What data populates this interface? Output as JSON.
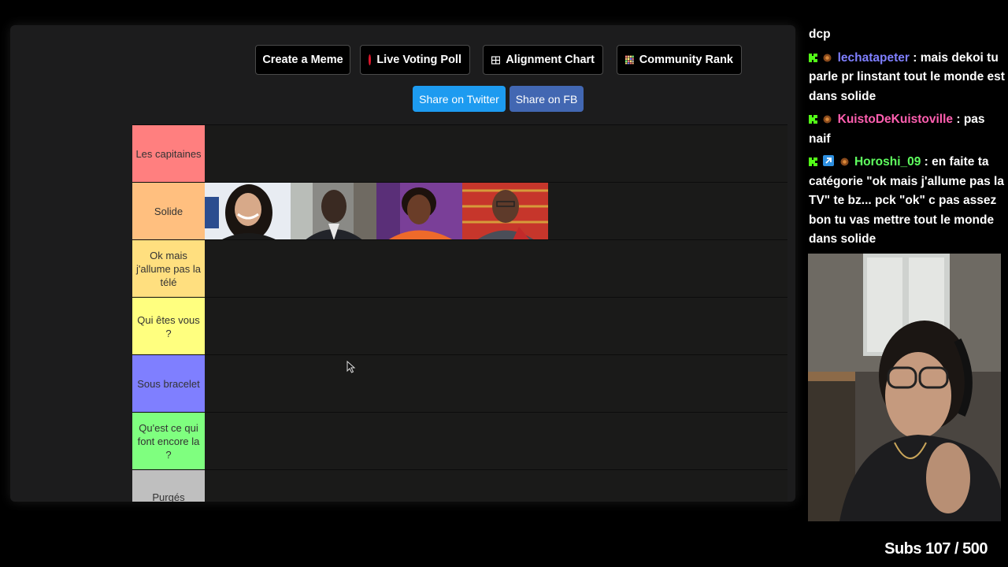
{
  "toolbar": {
    "create_meme": "Create a Meme",
    "live_poll": "Live Voting Poll",
    "alignment": "Alignment Chart",
    "community": "Community Rank",
    "share_twitter": "Share on Twitter",
    "share_fb": "Share on FB"
  },
  "colors": {
    "twitter": "#1d9bf0",
    "facebook": "#4267b2"
  },
  "tiers": [
    {
      "label": "Les capitaines",
      "color": "#ff7f7f"
    },
    {
      "label": "Solide",
      "color": "#ffbf7f"
    },
    {
      "label": "Ok mais j'allume pas la télé",
      "color": "#ffdf7f"
    },
    {
      "label": "Qui êtes vous ?",
      "color": "#ffff7f"
    },
    {
      "label": "Sous bracelet",
      "color": "#7f7fff"
    },
    {
      "label": "Qu'est ce qui font encore la ?",
      "color": "#7fff7f"
    },
    {
      "label": "Purgés",
      "color": "#bfbfbf"
    }
  ],
  "chat": {
    "messages": [
      {
        "user": "",
        "text": "dcp"
      },
      {
        "user": "lechatapeter",
        "user_color": "#7f7fff",
        "text": " : mais dekoi tu parle pr linstant tout le monde est dans solide"
      },
      {
        "user": "KuistoDeKuistoville",
        "user_color": "#ff5fb0",
        "text": " : pas naif"
      },
      {
        "user": "Horoshi_09",
        "user_color": "#5fff5f",
        "text": " : en faite ta catégorie \"ok mais j'allume pas la TV\" te bz... pck \"ok\" c pas assez bon tu vas mettre tout le monde dans solide"
      }
    ]
  },
  "subs": "Subs 107 / 500"
}
